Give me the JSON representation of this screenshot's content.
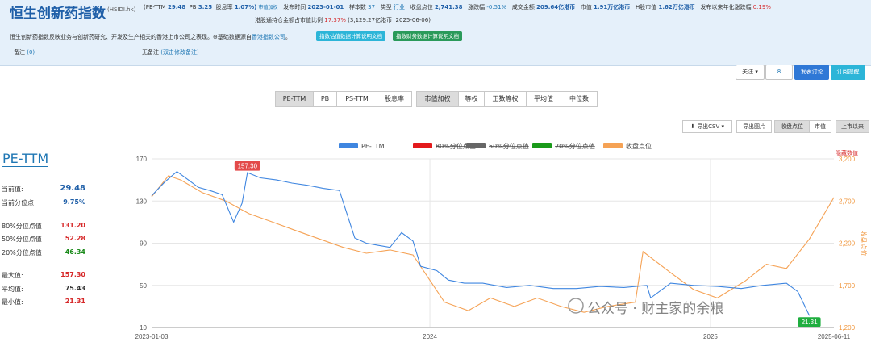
{
  "header": {
    "title": "恒生创新药指数",
    "code": "(HSIDI.hk)",
    "stats": {
      "pe_label": "(PE-TTM",
      "pe_value": "29.48",
      "pb_label": "PB",
      "pb_value": "3.25",
      "dy_label": "股息率",
      "dy_value": "1.07%)",
      "stats_link": "市值加权",
      "publish_label": "发布时间",
      "publish_value": "2023-01-01",
      "sample_label": "样本数",
      "sample_value": "37",
      "type_label": "类型",
      "type_value": "行业",
      "close_label": "收盘点位",
      "close_value": "2,741.38",
      "chg_label": "涨跌幅",
      "chg_value": "-0.51%",
      "turnover_label": "成交金额",
      "turnover_value": "209.64亿港币",
      "mcap_label": "市值",
      "mcap_value": "1.91万亿港币",
      "hmcap_label": "H股市值",
      "hmcap_value": "1.62万亿港币",
      "annual_label": "发布以来年化涨跌幅",
      "annual_value": "0.19%"
    },
    "connect": {
      "label": "港股通持仓金额占市值比例",
      "pct": "17.37%",
      "amount": "(3,129.27亿港币",
      "date": "2025-06-06)"
    },
    "description": "恒生创新药指数反映业务与创新药研究、开发及生产相关的香港上市公司之表现。⊕基础数据源自",
    "desc_link": "香港指数公司",
    "desc_end": "。",
    "doc_btn_1": "指数估值数据计算说明文档",
    "doc_btn_2": "指数财务数据计算说明文档",
    "note_label": "备注",
    "note_link": "(0)",
    "remark_label": "无备注",
    "remark_link": "(双击修改备注)",
    "colors": {
      "doc1": "#2cb5d8",
      "doc2": "#2a9a5a",
      "title": "#1f5fa8"
    }
  },
  "follow": {
    "follow_label": "关注 ▾",
    "count": "8",
    "discuss": "发表讨论",
    "subscribe": "订阅提醒"
  },
  "metric_tabs": [
    "PE-TTM",
    "PB",
    "PS-TTM",
    "股息率"
  ],
  "weight_tabs": [
    "市值加权",
    "等权",
    "正数等权",
    "平均值",
    "中位数"
  ],
  "tools": {
    "export_csv": "导出CSV ▾",
    "export_img": "导出图片",
    "close_pt": "收盘点位",
    "mcap": "市值",
    "since_listing": "上市以来"
  },
  "left_panel": {
    "title": "PE-TTM",
    "current_label": "当前值:",
    "current_value": "29.48",
    "pct_label": "当前分位点",
    "pct_value": "9.75%",
    "p80_label": "80%分位点值",
    "p80_value": "131.20",
    "p50_label": "50%分位点值",
    "p50_value": "52.28",
    "p20_label": "20%分位点值",
    "p20_value": "46.34",
    "max_label": "最大值:",
    "max_value": "157.30",
    "avg_label": "平均值:",
    "avg_value": "75.43",
    "min_label": "最小值:",
    "min_value": "21.31"
  },
  "chart_data": {
    "type": "line",
    "legend": [
      "PE-TTM",
      "80%分位点值",
      "50%分位点值",
      "20%分位点值",
      "收盘点位"
    ],
    "legend_colors": [
      "#3f86e0",
      "#e31a1c",
      "#666666",
      "#1a9a1a",
      "#f5a255"
    ],
    "legend_placement": "top",
    "hide_label": "隐藏数值",
    "right_axis_label": "收盘点位",
    "x_ticks": [
      "2023-01-03",
      "2024",
      "2025",
      "2025-06-11"
    ],
    "x_range": [
      "2023-01-03",
      "2025-06-11"
    ],
    "y_left": {
      "ticks": [
        10,
        50,
        90,
        130,
        170
      ],
      "range": [
        10,
        170
      ]
    },
    "y_right": {
      "ticks": [
        1200,
        1700,
        2200,
        2700,
        3200
      ],
      "range": [
        1200,
        3200
      ]
    },
    "max_annotation": {
      "date": "2023-05-08",
      "value": 157.3,
      "label": "157.30"
    },
    "min_annotation": {
      "date": "2025-05-10",
      "value": 21.31,
      "label": "21.31"
    },
    "pe_series": [
      [
        "2023-01-03",
        135
      ],
      [
        "2023-01-20",
        148
      ],
      [
        "2023-02-05",
        158
      ],
      [
        "2023-02-20",
        150
      ],
      [
        "2023-03-05",
        143
      ],
      [
        "2023-03-20",
        140
      ],
      [
        "2023-04-05",
        136
      ],
      [
        "2023-04-20",
        110
      ],
      [
        "2023-05-01",
        128
      ],
      [
        "2023-05-08",
        157
      ],
      [
        "2023-05-25",
        152
      ],
      [
        "2023-06-15",
        150
      ],
      [
        "2023-07-05",
        147
      ],
      [
        "2023-07-25",
        145
      ],
      [
        "2023-08-15",
        142
      ],
      [
        "2023-09-05",
        140
      ],
      [
        "2023-09-25",
        95
      ],
      [
        "2023-10-10",
        90
      ],
      [
        "2023-10-25",
        88
      ],
      [
        "2023-11-10",
        86
      ],
      [
        "2023-11-25",
        100
      ],
      [
        "2023-12-10",
        92
      ],
      [
        "2023-12-20",
        68
      ],
      [
        "2024-01-10",
        64
      ],
      [
        "2024-01-25",
        55
      ],
      [
        "2024-02-15",
        52
      ],
      [
        "2024-03-10",
        52
      ],
      [
        "2024-04-10",
        48
      ],
      [
        "2024-05-10",
        50
      ],
      [
        "2024-06-10",
        47
      ],
      [
        "2024-07-10",
        47
      ],
      [
        "2024-08-10",
        49
      ],
      [
        "2024-09-10",
        48
      ],
      [
        "2024-10-10",
        50
      ],
      [
        "2024-10-15",
        38
      ],
      [
        "2024-11-10",
        52
      ],
      [
        "2024-12-10",
        50
      ],
      [
        "2025-01-10",
        49
      ],
      [
        "2025-02-10",
        47
      ],
      [
        "2025-03-10",
        50
      ],
      [
        "2025-04-10",
        52
      ],
      [
        "2025-04-25",
        44
      ],
      [
        "2025-05-10",
        21.31
      ]
    ],
    "close_series": [
      [
        "2023-01-03",
        2750
      ],
      [
        "2023-01-25",
        3000
      ],
      [
        "2023-02-10",
        2950
      ],
      [
        "2023-03-10",
        2800
      ],
      [
        "2023-04-10",
        2700
      ],
      [
        "2023-05-10",
        2550
      ],
      [
        "2023-06-10",
        2450
      ],
      [
        "2023-07-10",
        2350
      ],
      [
        "2023-08-10",
        2250
      ],
      [
        "2023-09-10",
        2150
      ],
      [
        "2023-10-10",
        2080
      ],
      [
        "2023-11-10",
        2120
      ],
      [
        "2023-12-10",
        2060
      ],
      [
        "2024-01-20",
        1500
      ],
      [
        "2024-02-20",
        1400
      ],
      [
        "2024-03-20",
        1550
      ],
      [
        "2024-04-20",
        1450
      ],
      [
        "2024-05-20",
        1550
      ],
      [
        "2024-06-20",
        1450
      ],
      [
        "2024-07-20",
        1380
      ],
      [
        "2024-08-20",
        1450
      ],
      [
        "2024-09-25",
        1500
      ],
      [
        "2024-10-05",
        2100
      ],
      [
        "2024-11-10",
        1850
      ],
      [
        "2024-12-10",
        1650
      ],
      [
        "2025-01-10",
        1550
      ],
      [
        "2025-02-15",
        1750
      ],
      [
        "2025-03-15",
        1950
      ],
      [
        "2025-04-10",
        1900
      ],
      [
        "2025-05-10",
        2250
      ],
      [
        "2025-06-11",
        2741.38
      ]
    ],
    "annotations": "公众号 · 财主家的余粮"
  }
}
